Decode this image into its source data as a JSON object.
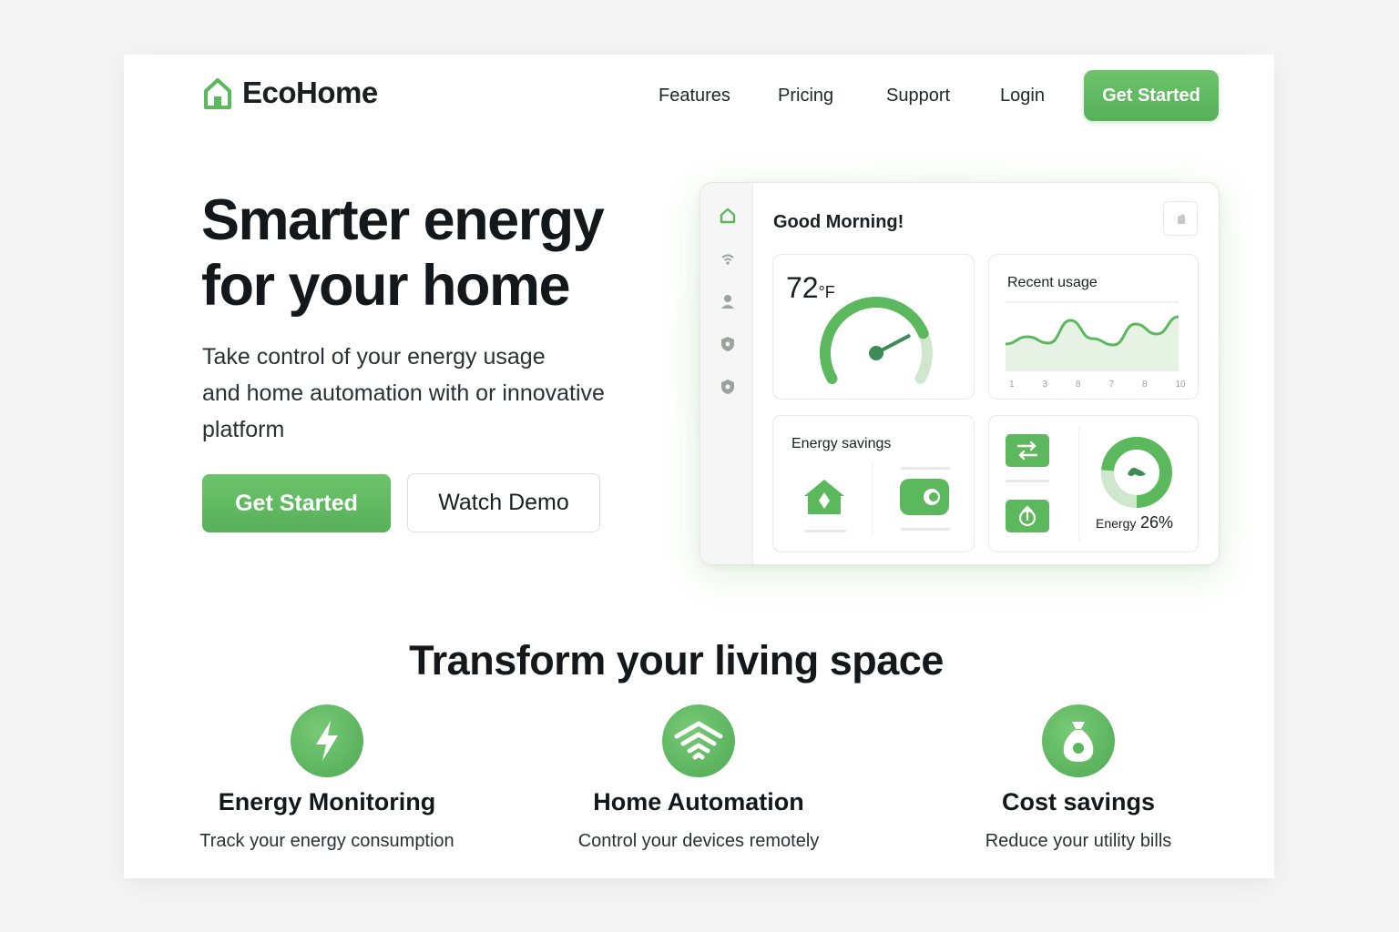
{
  "brand": {
    "name": "EcoHome",
    "accent": "#5cb85c"
  },
  "nav": {
    "links": [
      "Features",
      "Pricing",
      "Support",
      "Login"
    ],
    "cta": "Get Started"
  },
  "hero": {
    "title_line1": "Smarter energy",
    "title_line2": "for your home",
    "subtitle_line1": "Take control of your energy usage",
    "subtitle_line2": "and home automation with or innovative",
    "subtitle_line3": "platform",
    "primary_button": "Get Started",
    "secondary_button": "Watch Demo"
  },
  "dashboard": {
    "greeting": "Good Morning!",
    "sidebar_icons": [
      "home-icon",
      "wifi-icon",
      "user-icon",
      "shield-icon",
      "shield-icon"
    ],
    "thermostat": {
      "value": "72",
      "unit": "°F",
      "level": 0.78
    },
    "recent_usage": {
      "title": "Recent usage",
      "x_ticks": [
        "1",
        "3",
        "8",
        "7",
        "8",
        "10"
      ],
      "values": [
        3.0,
        3.8,
        3.1,
        5.6,
        3.6,
        2.9,
        5.2,
        4.1,
        6.0
      ]
    },
    "energy_savings": {
      "title": "Energy savings",
      "icons": [
        "house-icon",
        "toggle-icon"
      ]
    },
    "energy": {
      "label": "Energy",
      "value": "26%",
      "fraction": 0.26,
      "icons": [
        "swap-icon",
        "upload-icon"
      ]
    }
  },
  "features": {
    "title": "Transform your living space",
    "items": [
      {
        "icon": "lightning-icon",
        "title": "Energy Monitoring",
        "desc": "Track your energy consumption"
      },
      {
        "icon": "wifi-icon",
        "title": "Home Automation",
        "desc": "Control your devices remotely"
      },
      {
        "icon": "money-bag-icon",
        "title": "Cost savings",
        "desc": "Reduce your utility bills"
      }
    ]
  }
}
